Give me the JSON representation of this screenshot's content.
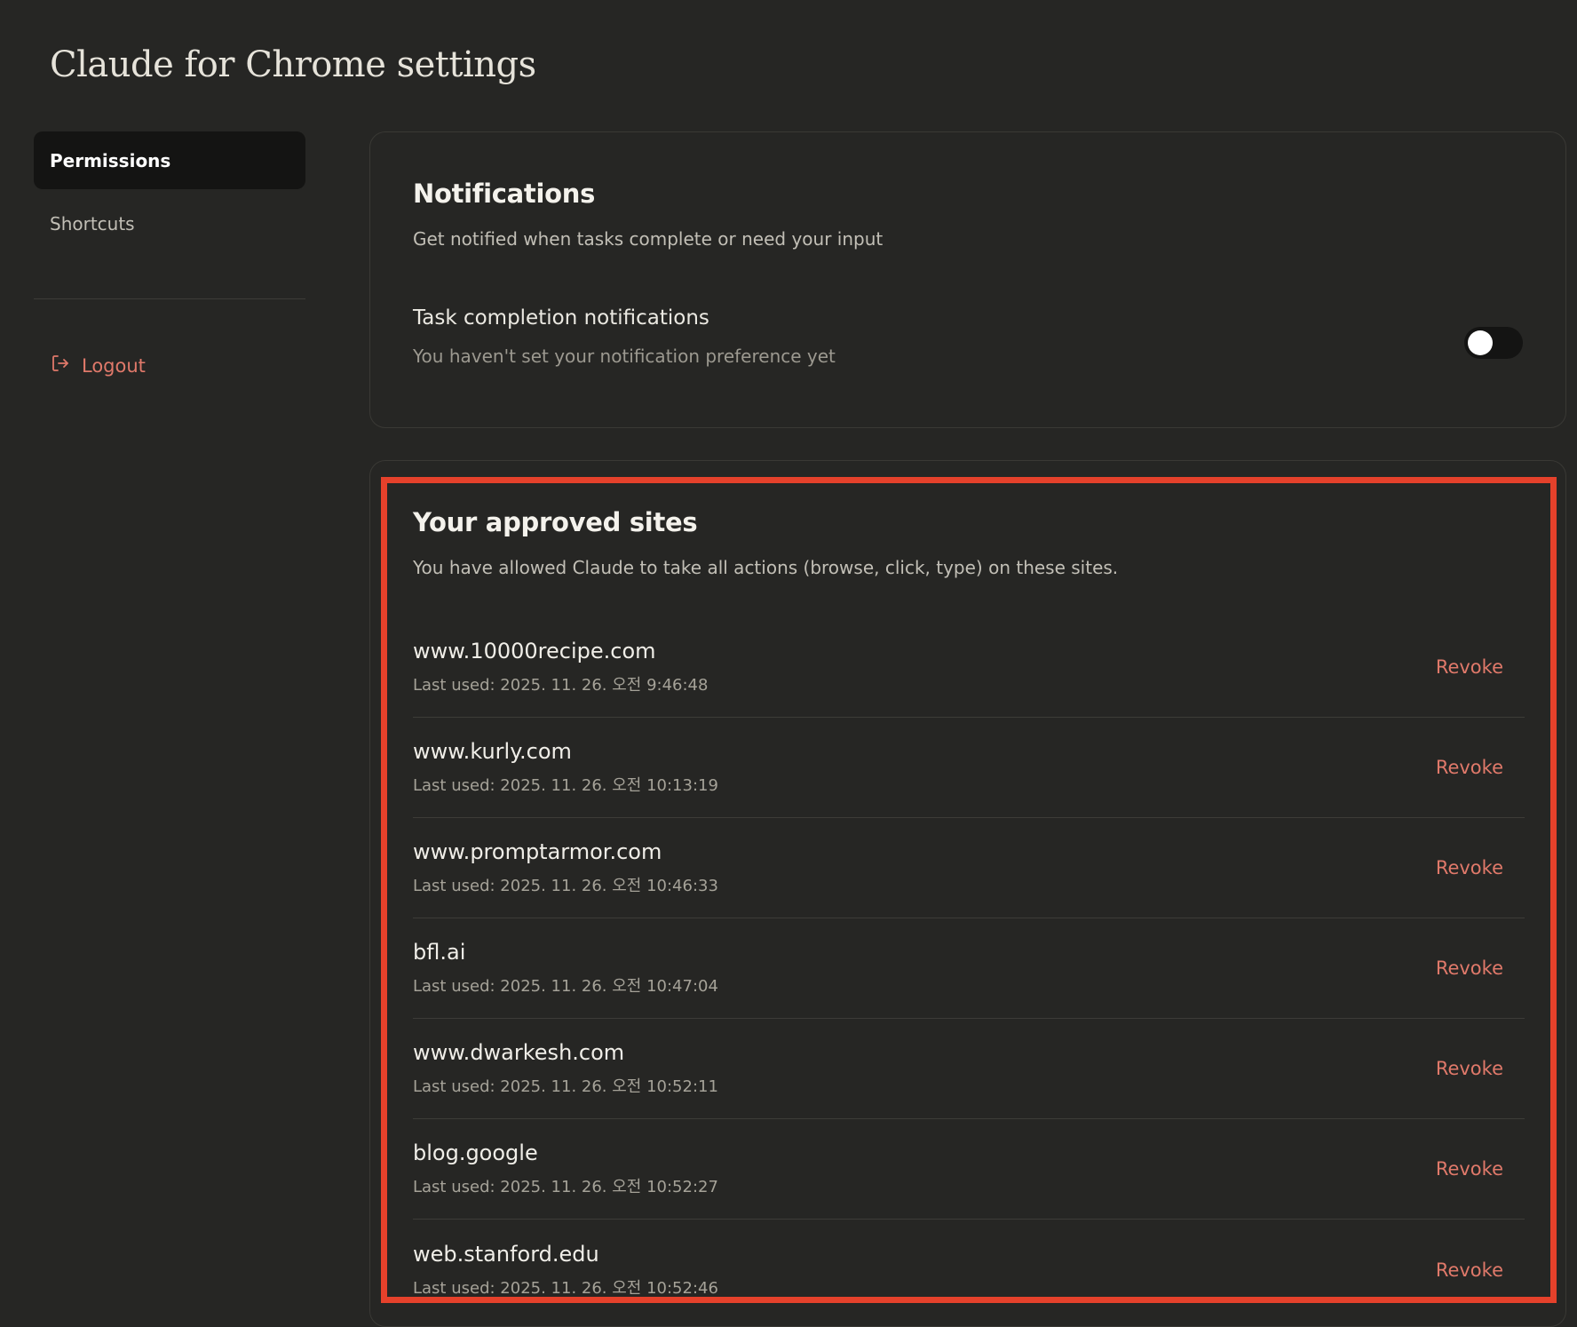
{
  "page": {
    "title": "Claude for Chrome settings"
  },
  "sidebar": {
    "items": [
      {
        "label": "Permissions",
        "active": true
      },
      {
        "label": "Shortcuts",
        "active": false
      }
    ],
    "logout_label": "Logout"
  },
  "notifications": {
    "title": "Notifications",
    "subtitle": "Get notified when tasks complete or need your input",
    "setting_label": "Task completion notifications",
    "setting_desc": "You haven't set your notification preference yet",
    "toggle_on": false
  },
  "approved_sites": {
    "title": "Your approved sites",
    "subtitle": "You have allowed Claude to take all actions (browse, click, type) on these sites.",
    "revoke_label": "Revoke",
    "sites": [
      {
        "domain": "www.10000recipe.com",
        "last_used": "Last used: 2025. 11. 26. 오전 9:46:48"
      },
      {
        "domain": "www.kurly.com",
        "last_used": "Last used: 2025. 11. 26. 오전 10:13:19"
      },
      {
        "domain": "www.promptarmor.com",
        "last_used": "Last used: 2025. 11. 26. 오전 10:46:33"
      },
      {
        "domain": "bfl.ai",
        "last_used": "Last used: 2025. 11. 26. 오전 10:47:04"
      },
      {
        "domain": "www.dwarkesh.com",
        "last_used": "Last used: 2025. 11. 26. 오전 10:52:11"
      },
      {
        "domain": "blog.google",
        "last_used": "Last used: 2025. 11. 26. 오전 10:52:27"
      },
      {
        "domain": "web.stanford.edu",
        "last_used": "Last used: 2025. 11. 26. 오전 10:52:46"
      }
    ]
  },
  "colors": {
    "accent": "#e0796a",
    "highlight": "#e5412b",
    "background": "#262624"
  },
  "icons": {
    "logout": "logout-icon"
  }
}
